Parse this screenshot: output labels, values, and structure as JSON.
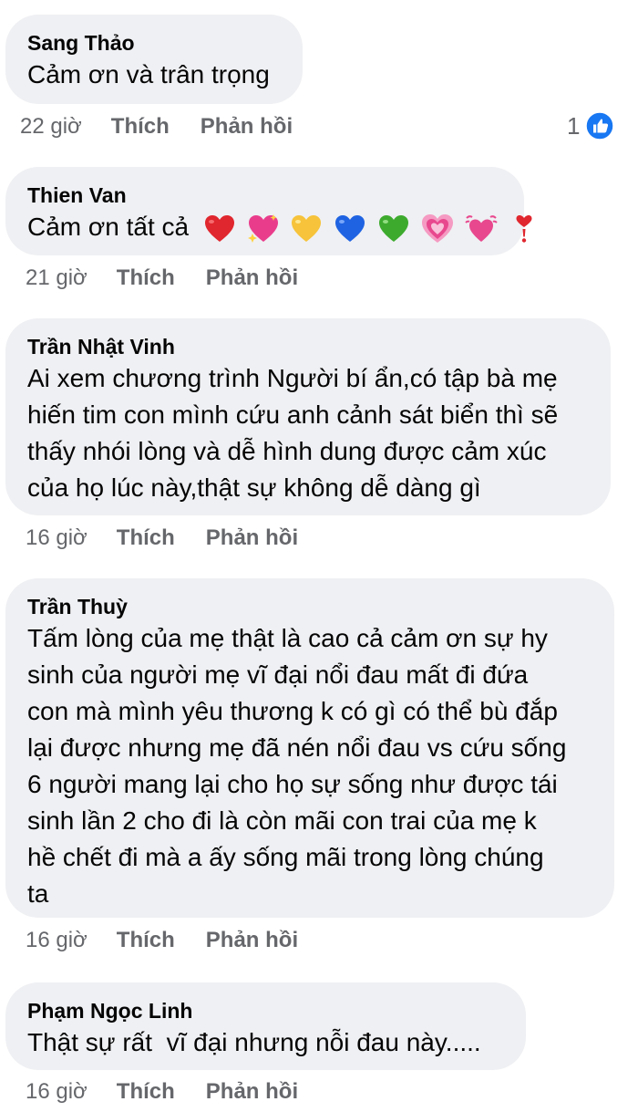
{
  "comments": [
    {
      "author": "Sang Thảo",
      "lines": [
        "Cảm ơn và trân trọng"
      ],
      "time": "22 giờ",
      "like_label": "Thích",
      "reply_label": "Phản hồi",
      "reaction_count": "1",
      "reaction_icon": "like-icon",
      "reaction_color": "#1877f2"
    },
    {
      "author": "Thien Van",
      "lines": [
        "Cảm ơn tất cả"
      ],
      "emojis": [
        "red-heart",
        "sparkling-heart",
        "yellow-heart",
        "blue-heart",
        "green-heart",
        "growing-heart",
        "beating-heart",
        "heart-exclamation"
      ],
      "time": "21 giờ",
      "like_label": "Thích",
      "reply_label": "Phản hồi"
    },
    {
      "author": "Trần Nhật Vinh",
      "lines": [
        "Ai xem chương trình Người bí ẩn,có tập bà mẹ",
        "hiến tim con mình cứu anh cảnh sát biển thì sẽ",
        "thấy nhói lòng và dễ hình dung được cảm xúc",
        "của họ lúc này,thật sự không dễ dàng gì"
      ],
      "time": "16 giờ",
      "like_label": "Thích",
      "reply_label": "Phản hồi"
    },
    {
      "author": "Trần Thuỳ",
      "lines": [
        "Tấm lòng của mẹ thật là cao cả cảm ơn sự hy",
        "sinh của người mẹ vĩ đại nổi đau mất đi đứa",
        "con mà mình yêu thương k có gì có thể bù đắp",
        "lại được nhưng mẹ đã nén nổi đau vs cứu sống",
        "6 người mang lại cho họ sự sống như được tái",
        "sinh lần 2 cho đi là còn mãi con trai của mẹ k",
        "hề chết đi mà a ấy sống mãi trong lòng chúng",
        "ta"
      ],
      "time": "16 giờ",
      "like_label": "Thích",
      "reply_label": "Phản hồi"
    },
    {
      "author": "Phạm Ngọc Linh",
      "lines": [
        "Thật sự rất  vĩ đại nhưng nỗi đau này....."
      ],
      "time": "16 giờ",
      "like_label": "Thích",
      "reply_label": "Phản hồi"
    }
  ],
  "colors": {
    "bubble": "#eff0f3",
    "meta_text": "#65676b",
    "like_blue": "#1877f2"
  }
}
